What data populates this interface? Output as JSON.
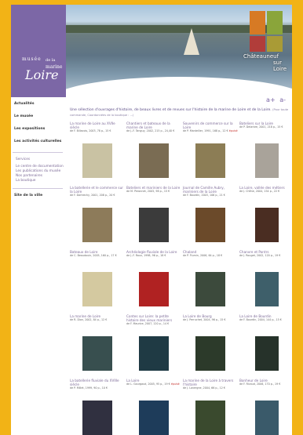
{
  "logo": {
    "line1": "musée",
    "line2": "de la",
    "line3": "marine",
    "line4": "Loire"
  },
  "header": {
    "badge_line1": "Châteauneuf",
    "badge_line2": "sur Loire"
  },
  "font_controls": {
    "increase": "a+",
    "decrease": "a-"
  },
  "sidebar": {
    "items": [
      {
        "label": "Actualités"
      },
      {
        "label": "Le musée"
      },
      {
        "label": "Les expositions"
      },
      {
        "label": "Les activités culturelles"
      }
    ],
    "section": "Services",
    "sub_items": [
      {
        "label": "Le centre de documentation"
      },
      {
        "label": "Les publications du musée"
      },
      {
        "label": "Nos partenaires"
      },
      {
        "label": "La boutique"
      }
    ],
    "footer": "Site de la ville"
  },
  "intro": {
    "text": "Une sélection d'ouvrages d'histoire, de beaux livres et de revues sur l'histoire de la marine de Loire et de la Loire.",
    "note": "(Pour toute commande, Coordonnées de la boutique : ...)"
  },
  "books": [
    [
      {
        "title": "La marine de Loire au XVIIe siècle",
        "meta": "de F. Billacois, 2003, 78 p., 15 €"
      },
      {
        "title": "Chantiers et bateaux de la marine de Loire",
        "meta": "de J.-F. Tanguy, 2002, 215 p., 24,40 €"
      },
      {
        "title": "Souvenirs de commerce sur la Loire",
        "meta": "de P. Mantellier, 1991, 168 p., 12 €",
        "extra": "épuisé"
      },
      {
        "title": "Bateliers sur la Loire",
        "meta": "de P. Delarbre, 2001, 218 p., 15 €"
      }
    ],
    [
      {
        "title": "La batellerie et le commerce sur la Loire",
        "meta": "de F. Dartrechy, 2001, 208 p., 20 €"
      },
      {
        "title": "Bateliers et mariniers de la Loire",
        "meta": "de M. Peronnet, 2005, 98 p., 15 €"
      },
      {
        "title": "Journal de Camille Aubry, mariniers de la Loire",
        "meta": "de F. Bourdin, 2003, 106 p., 21 €"
      },
      {
        "title": "La Loire, vallée des métiers",
        "meta": "de J. Chêne, 2004, 154 p., 22 €"
      }
    ],
    [
      {
        "title": "Bateaux de Loire",
        "meta": "de C. Beaudouin, 2005, 160 p., 17 €"
      },
      {
        "title": "Archéologie fluviale de la Loire",
        "meta": "de J.-F. Roux, 1998, 96 p., 18 €"
      },
      {
        "title": "Chaland",
        "meta": "de P. Flumin, 2006, 64 p., 18 €"
      },
      {
        "title": "Chanvre et Pontrs",
        "meta": "de J. Rouget, 2002, 120 p., 19 €"
      }
    ],
    [
      {
        "title": "La marine de Loire",
        "meta": "de R. Dion, 2002, 84 p., 12 €"
      },
      {
        "title": "Contes sur Loire: la petite histoire des vieux mariniers",
        "meta": "de F. Maurice, 2007, 120 p., 14 €"
      },
      {
        "title": "La Loire de Bourg",
        "meta": "de J. Perruchet, 2004, 96 p., 15 €"
      },
      {
        "title": "La Loire de Bourdin",
        "meta": "de F. Bourdin, 2004, 144 p., 15 €"
      }
    ],
    [
      {
        "title": "La batellerie fluviale du XVIIIe siècle",
        "meta": "de P. Millet, 1999, 90 p., 10 €"
      },
      {
        "title": "La Loire",
        "meta": "de L. Gourgaud, 2005, 95 p., 19 €",
        "extra": "épuisé"
      },
      {
        "title": "La marine de la Loire à travers l'histoire",
        "meta": "de J. Lavergne, 2004, 66 p., 12 €"
      },
      {
        "title": "Bonheur de Loire",
        "meta": "de F. Ricaud, 2006, 170 p., 19 €"
      }
    ]
  ]
}
